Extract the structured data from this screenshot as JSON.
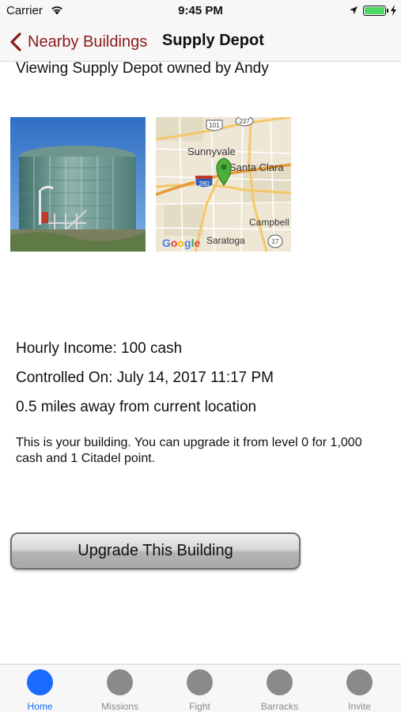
{
  "status_bar": {
    "carrier": "Carrier",
    "time": "9:45 PM",
    "battery_level": 1.0,
    "battery_color": "#4cd964",
    "wifi_icon": "wifi-icon",
    "location_icon": "location-arrow-icon",
    "charging_icon": "bolt-icon"
  },
  "nav": {
    "back_label": "Nearby Buildings",
    "back_icon": "chevron-left-icon",
    "title": "Supply Depot",
    "accent_color": "#8b1a1a"
  },
  "building": {
    "viewing_text": "Viewing Supply Depot owned by Andy",
    "photo": "storage-tank-photo",
    "map": {
      "labels": [
        "Sunnyvale",
        "Santa Clara",
        "Campbell",
        "Saratoga"
      ],
      "highways": [
        "101",
        "237",
        "280",
        "17"
      ],
      "brand": "Google",
      "pin": "map-pin-icon"
    },
    "hourly_income": "Hourly Income: 100 cash",
    "controlled_on": "Controlled On: July 14, 2017 11:17 PM",
    "distance": "0.5 miles away from current location",
    "note": "This is your building. You can upgrade it from level 0 for 1,000 cash and 1 Citadel point."
  },
  "actions": {
    "upgrade_label": "Upgrade This Building"
  },
  "tabs": [
    {
      "label": "Home",
      "active": true
    },
    {
      "label": "Missions",
      "active": false
    },
    {
      "label": "Fight",
      "active": false
    },
    {
      "label": "Barracks",
      "active": false
    },
    {
      "label": "Invite",
      "active": false
    }
  ],
  "colors": {
    "tab_active": "#1a6bff",
    "tab_inactive": "#8a8a8a"
  }
}
